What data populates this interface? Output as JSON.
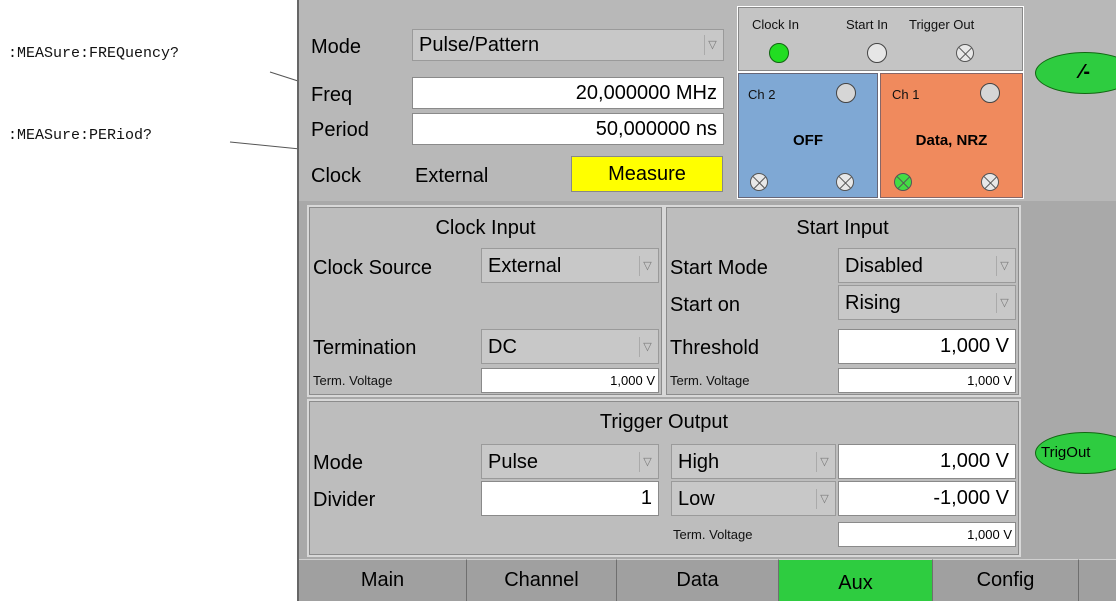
{
  "annotations": {
    "freq_cmd": ":MEASure:FREQuency?",
    "period_cmd": ":MEASure:PERiod?"
  },
  "top": {
    "mode_label": "Mode",
    "mode_value": "Pulse/Pattern",
    "freq_label": "Freq",
    "freq_value": "20,000000 MHz",
    "period_label": "Period",
    "period_value": "50,000000 ns",
    "clock_label": "Clock",
    "clock_value": "External",
    "measure_button": "Measure"
  },
  "indicators": {
    "clock_in": "Clock In",
    "start_in": "Start In",
    "trigger_out": "Trigger Out"
  },
  "channels": {
    "ch2_label": "Ch 2",
    "ch2_state": "OFF",
    "ch1_label": "Ch 1",
    "ch1_state": "Data, NRZ"
  },
  "clock_input": {
    "title": "Clock Input",
    "source_label": "Clock Source",
    "source_value": "External",
    "termination_label": "Termination",
    "termination_value": "DC",
    "term_voltage_label": "Term. Voltage",
    "term_voltage_value": "1,000 V"
  },
  "start_input": {
    "title": "Start Input",
    "mode_label": "Start Mode",
    "mode_value": "Disabled",
    "start_on_label": "Start on",
    "start_on_value": "Rising",
    "threshold_label": "Threshold",
    "threshold_value": "1,000 V",
    "term_voltage_label": "Term. Voltage",
    "term_voltage_value": "1,000 V"
  },
  "trigger_output": {
    "title": "Trigger Output",
    "mode_label": "Mode",
    "mode_value": "Pulse",
    "divider_label": "Divider",
    "divider_value": "1",
    "high_label": "High",
    "high_value": "1,000 V",
    "low_label": "Low",
    "low_value": "-1,000 V",
    "term_voltage_label": "Term. Voltage",
    "term_voltage_value": "1,000 V",
    "trigout_button": "TrigOut"
  },
  "tabs": [
    "Main",
    "Channel",
    "Data",
    "Aux",
    "Config"
  ],
  "active_tab": "Aux",
  "colors": {
    "ch2_bg": "#7fa8d4",
    "ch1_bg": "#f08a5d",
    "measure_bg": "#ffff00",
    "active_green": "#2ecc40"
  }
}
